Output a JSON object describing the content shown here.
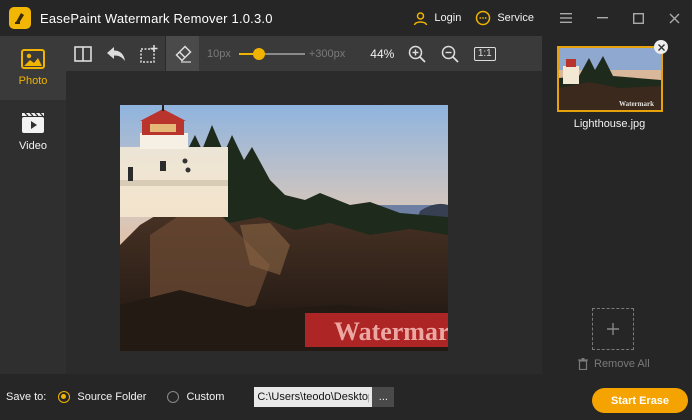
{
  "app": {
    "title": "EasePaint Watermark Remover  1.0.3.0"
  },
  "header": {
    "login_label": "Login",
    "service_label": "Service"
  },
  "nav": [
    {
      "label": "Photo",
      "icon": "photo-icon",
      "active": true
    },
    {
      "label": "Video",
      "icon": "video-icon",
      "active": false
    }
  ],
  "toolbar": {
    "brush_min": "10px",
    "brush_max": "+300px",
    "brush_level": 0.3,
    "zoom": "44%",
    "ratio_label": "1:1"
  },
  "image": {
    "watermark_text": "Watermark"
  },
  "files": {
    "items": [
      {
        "name": "Lighthouse.jpg",
        "watermark_text": "Watermark"
      }
    ],
    "remove_all_label": "Remove All"
  },
  "footer": {
    "save_to_label": "Save to:",
    "source_folder_label": "Source Folder",
    "custom_label": "Custom",
    "path_value": "C:\\Users\\teodo\\Desktop",
    "browse_label": "...",
    "start_label": "Start Erase"
  },
  "colors": {
    "accent": "#f0b400",
    "start_button": "#f4a300",
    "selected_border": "#e5a20a"
  }
}
